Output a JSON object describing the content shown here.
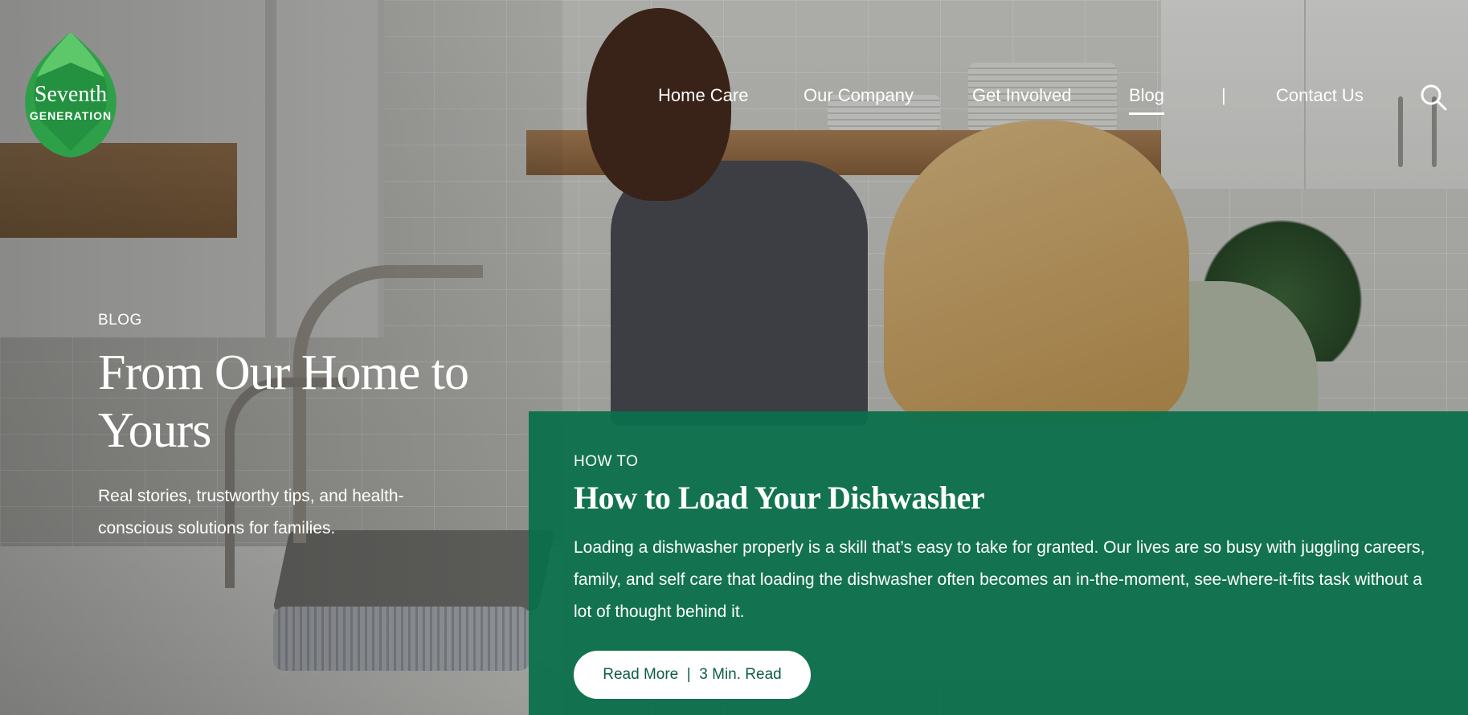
{
  "brand": {
    "name_line1": "Seventh",
    "name_line2": "GENERATION",
    "leaf_color": "#2fa04a"
  },
  "nav": {
    "items": [
      {
        "label": "Home Care"
      },
      {
        "label": "Our Company"
      },
      {
        "label": "Get Involved"
      },
      {
        "label": "Blog",
        "active": true
      },
      {
        "label": "|"
      },
      {
        "label": "Contact Us"
      }
    ],
    "search_icon": "search-icon"
  },
  "hero": {
    "eyebrow": "BLOG",
    "title": "From Our Home to Yours",
    "subtitle": "Real stories, trustworthy tips, and health-conscious solutions for families."
  },
  "feature": {
    "kicker": "HOW TO",
    "title": "How to Load Your Dishwasher",
    "body": "Loading a dishwasher properly is a skill that’s easy to take for granted. Our lives are so busy with juggling careers, family, and self care that loading the dishwasher often becomes an in-the-moment, see-where-it-fits task without a lot of thought behind it.",
    "button_label": "Read More  |  3 Min. Read",
    "panel_color": "#0a704b"
  }
}
